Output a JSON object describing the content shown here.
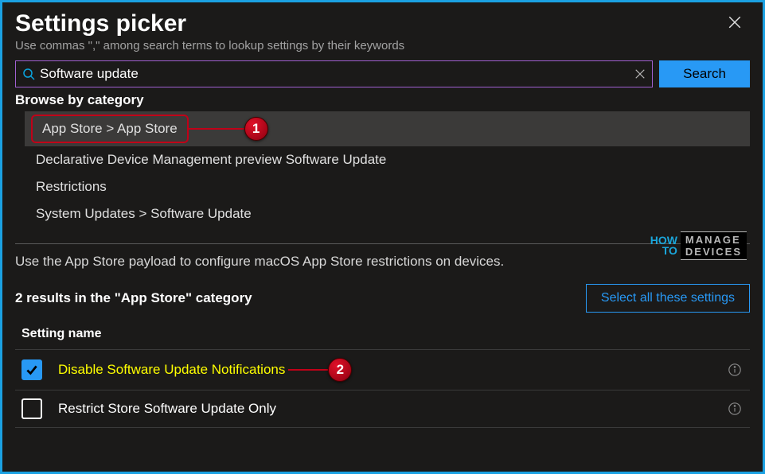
{
  "header": {
    "title": "Settings picker",
    "subtitle": "Use commas \",\" among search terms to lookup settings by their keywords"
  },
  "search": {
    "value": "Software update",
    "button": "Search"
  },
  "browse": {
    "heading": "Browse by category",
    "items": [
      "App Store > App Store",
      "Declarative Device Management preview Software Update",
      "Restrictions",
      "System Updates > Software Update"
    ]
  },
  "callouts": {
    "c1": "1",
    "c2": "2"
  },
  "watermark": {
    "how": "HOW",
    "to": "TO",
    "line1": "MANAGE",
    "line2": "DEVICES"
  },
  "description": "Use the App Store payload to configure macOS App Store restrictions on devices.",
  "results": {
    "summary": "2 results in the \"App Store\" category",
    "select_all": "Select all these settings",
    "column": "Setting name",
    "rows": [
      {
        "label": "Disable Software Update Notifications",
        "checked": true,
        "highlight": true
      },
      {
        "label": "Restrict Store Software Update Only",
        "checked": false,
        "highlight": false
      }
    ]
  }
}
